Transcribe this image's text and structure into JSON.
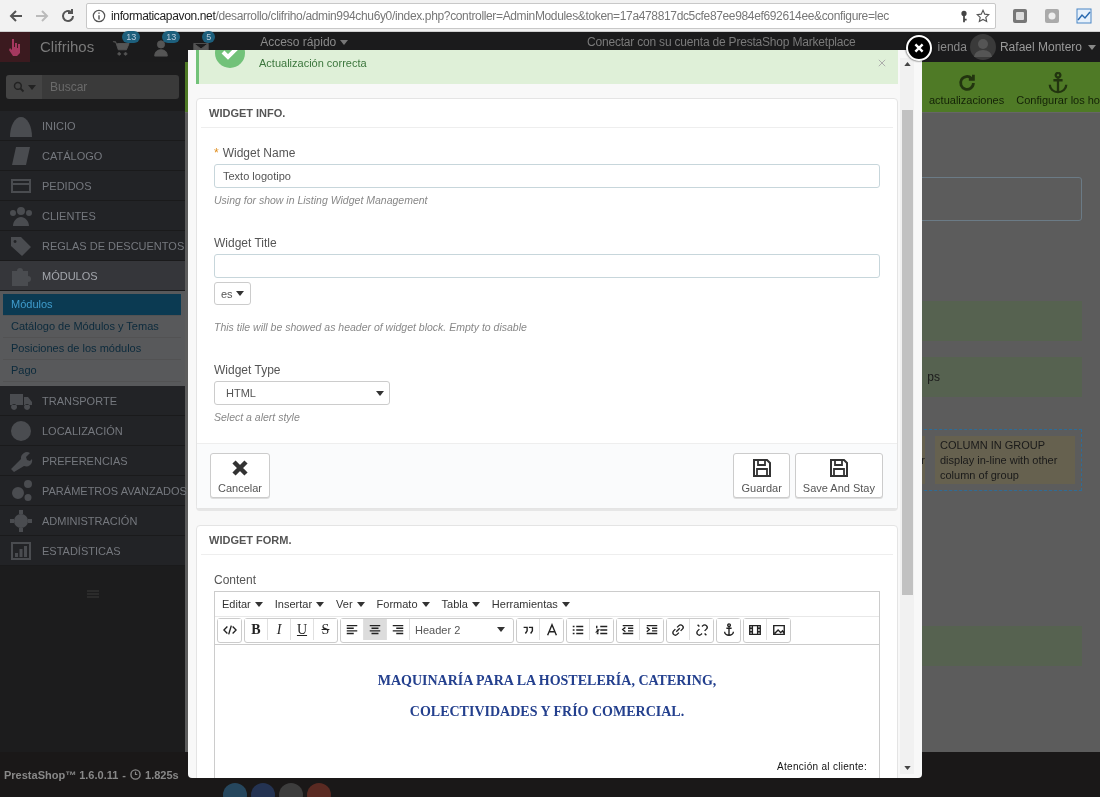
{
  "browser": {
    "url_host": "informaticapavon.net",
    "url_path": "/desarrollo/clifriho/admin994chu6y0/index.php?controller=AdminModules&token=17a478817dc5cfe87ee984ef692614ee&configure=lec"
  },
  "header": {
    "shop": "Clifrihos",
    "badges": [
      {
        "kind": "cart",
        "count": "13"
      },
      {
        "kind": "person",
        "count": "13"
      },
      {
        "kind": "mail",
        "count": "5"
      }
    ],
    "quick_access": "Acceso rápido",
    "marketplace": "Conectar con su cuenta de PrestaShop Marketplace",
    "shop_link": "ienda",
    "user": "Rafael Montero"
  },
  "search": {
    "placeholder": "Buscar"
  },
  "sidebar": {
    "items": [
      {
        "label": "INICIO",
        "selected": false
      },
      {
        "label": "CATÁLOGO",
        "selected": false
      },
      {
        "label": "PEDIDOS",
        "selected": false
      },
      {
        "label": "CLIENTES",
        "selected": false
      },
      {
        "label": "REGLAS DE DESCUENTOS",
        "selected": false
      },
      {
        "label": "MÓDULOS",
        "selected": true,
        "children": [
          {
            "label": "Módulos",
            "selected": true
          },
          {
            "label": "Catálogo de Módulos y Temas",
            "selected": false
          },
          {
            "label": "Posiciones de los módulos",
            "selected": false
          },
          {
            "label": "Pago",
            "selected": false
          }
        ]
      },
      {
        "label": "TRANSPORTE",
        "selected": false
      },
      {
        "label": "LOCALIZACIÓN",
        "selected": false
      },
      {
        "label": "PREFERENCIAS",
        "selected": false
      },
      {
        "label": "PARÁMETROS AVANZADOS",
        "selected": false
      },
      {
        "label": "ADMINISTRACIÓN",
        "selected": false
      },
      {
        "label": "ESTADÍSTICAS",
        "selected": false
      }
    ]
  },
  "toolbar": [
    {
      "kind": "refresh",
      "label": "actualizaciones"
    },
    {
      "kind": "anchor",
      "label": "Configurar los ho"
    }
  ],
  "content": {
    "row_text": "ps",
    "column_text": "r",
    "column_group": {
      "title": "COLUMN IN GROUP",
      "text": "display in-line with other column of group"
    }
  },
  "footer": {
    "version": "PrestaShop™ 1.6.0.11",
    "separator": "-",
    "time": "1.825s"
  },
  "modal": {
    "alert": "Actualización correcta",
    "info_panel": {
      "title": "WIDGET INFO.",
      "name": {
        "required_mark": "*",
        "label": "Widget Name",
        "value": "Texto logotipo",
        "help": "Using for show in Listing Widget Management"
      },
      "title_field": {
        "label": "Widget Title",
        "language": "es",
        "help": "This tile will be showed as header of widget block. Empty to disable"
      },
      "type": {
        "label": "Widget Type",
        "value": "HTML",
        "help": "Select a alert style"
      },
      "buttons": [
        {
          "kind": "cancel",
          "label": "Cancelar"
        },
        {
          "kind": "save",
          "label": "Guardar"
        },
        {
          "kind": "save",
          "label": "Save And Stay"
        }
      ]
    },
    "form_panel": {
      "title": "WIDGET FORM.",
      "content_label": "Content",
      "menus": [
        "Editar",
        "Insertar",
        "Ver",
        "Formato",
        "Tabla",
        "Herramientas"
      ],
      "tool_groups": [
        [
          {
            "kind": "code",
            "selected": false
          }
        ],
        [
          {
            "kind": "bold",
            "label": "B",
            "selected": false
          },
          {
            "kind": "italic",
            "label": "I",
            "selected": false
          },
          {
            "kind": "underline",
            "label": "U",
            "selected": false
          },
          {
            "kind": "strike",
            "label": "S",
            "selected": false
          }
        ],
        [
          {
            "kind": "align-left",
            "selected": false
          },
          {
            "kind": "align-center",
            "selected": true
          },
          {
            "kind": "align-right",
            "selected": false
          },
          {
            "kind": "select",
            "label": "Header 2",
            "selected": false
          }
        ],
        [
          {
            "kind": "quote",
            "selected": false
          },
          {
            "kind": "textcolor",
            "selected": false
          }
        ],
        [
          {
            "kind": "ul",
            "selected": false
          },
          {
            "kind": "ol",
            "selected": false
          }
        ],
        [
          {
            "kind": "outdent",
            "selected": false
          },
          {
            "kind": "indent",
            "selected": false
          }
        ],
        [
          {
            "kind": "link",
            "selected": false
          },
          {
            "kind": "unlink",
            "selected": false
          }
        ],
        [
          {
            "kind": "anchor",
            "selected": false
          }
        ],
        [
          {
            "kind": "media",
            "selected": false
          },
          {
            "kind": "image",
            "selected": false
          }
        ]
      ],
      "lines": [
        {
          "kind": "heading",
          "text": "MAQUINARÍA PARA LA HOSTELERÍA, CATERING,"
        },
        {
          "kind": "heading",
          "text": "COLECTIVIDADES Y FRÍO COMERCIAL."
        },
        {
          "kind": "note",
          "text": "Atención al cliente:"
        }
      ]
    }
  }
}
